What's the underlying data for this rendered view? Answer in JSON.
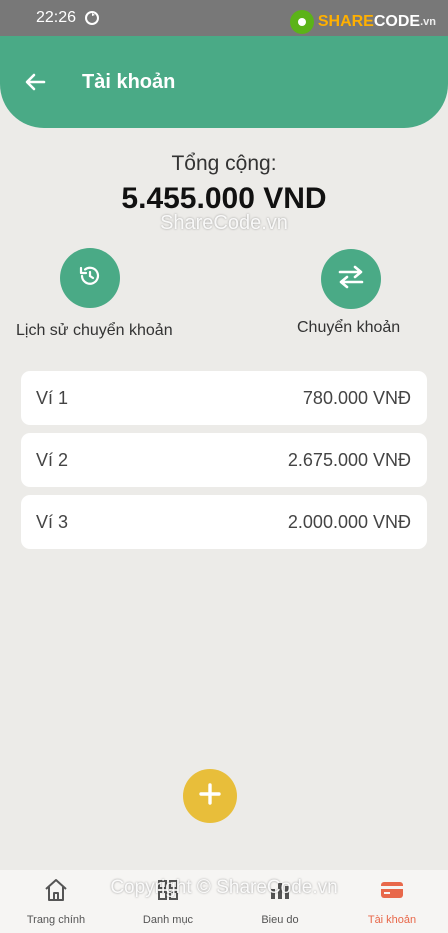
{
  "status_bar": {
    "time": "22:26"
  },
  "watermark": {
    "logo_share": "SHARE",
    "logo_code": "CODE",
    "logo_vn": ".vn",
    "center": "ShareCode.vn",
    "bottom": "Copyright © ShareCode.vn"
  },
  "header": {
    "title": "Tài khoản"
  },
  "summary": {
    "label": "Tổng cộng:",
    "value": "5.455.000 VND"
  },
  "actions": {
    "history_label": "Lịch sử chuyển khoản",
    "transfer_label": "Chuyển khoản"
  },
  "wallets": [
    {
      "name": "Ví 1",
      "amount": "780.000 VNĐ"
    },
    {
      "name": "Ví 2",
      "amount": "2.675.000 VNĐ"
    },
    {
      "name": "Ví 3",
      "amount": "2.000.000 VNĐ"
    }
  ],
  "bottom_nav": [
    {
      "label": "Trang chính",
      "icon": "home-icon"
    },
    {
      "label": "Danh mục",
      "icon": "category-icon"
    },
    {
      "label": "Bieu do",
      "icon": "chart-icon"
    },
    {
      "label": "Tài khoản",
      "icon": "card-icon",
      "active": true
    }
  ],
  "colors": {
    "primary": "#4aaa86",
    "fab": "#e8be3a",
    "active_tab": "#e8684a",
    "background": "#ecebe8"
  }
}
